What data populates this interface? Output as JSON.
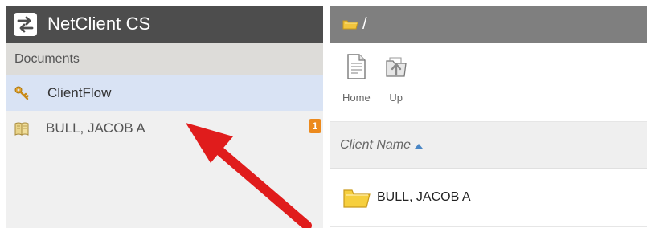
{
  "app": {
    "title": "NetClient CS",
    "logo_icon": "transfer-arrows-icon"
  },
  "sidebar": {
    "section_title": "Documents",
    "items": [
      {
        "label": "ClientFlow",
        "icon": "keys-icon",
        "active": true
      },
      {
        "label": "BULL, JACOB A",
        "icon": "client-book-icon",
        "badge": "1",
        "active": false
      }
    ]
  },
  "main": {
    "path": "/",
    "path_icon": "folder-icon",
    "toolbar": [
      {
        "label": "Home",
        "icon": "document-page-icon"
      },
      {
        "label": "Up",
        "icon": "folder-up-icon"
      }
    ],
    "table": {
      "columns": [
        {
          "label": "Client Name",
          "sort": "ascending"
        }
      ],
      "rows": [
        {
          "name": "BULL, JACOB A",
          "icon": "folder-icon"
        }
      ]
    }
  },
  "colors": {
    "header_dark": "#4d4d4d",
    "path_bar": "#7f7f7f",
    "active_item": "#d9e3f4",
    "badge": "#ec8a1d",
    "annotation_arrow": "#e01c1c"
  }
}
